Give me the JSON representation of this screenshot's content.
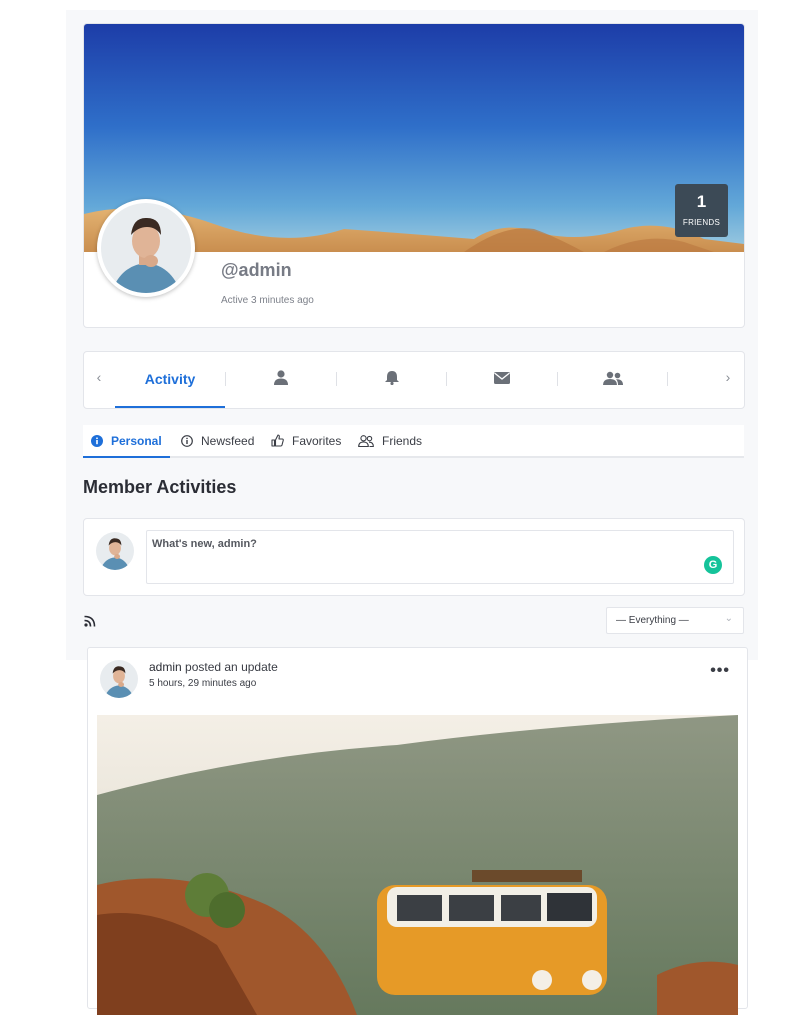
{
  "profile": {
    "username": "@admin",
    "last_active": "Active 3 minutes ago",
    "friends_count": "1",
    "friends_label": "FRIENDS"
  },
  "nav": {
    "prev_icon": "chevron-left-icon",
    "next_icon": "chevron-right-icon",
    "tabs": [
      {
        "label": "Activity",
        "icon": "activity"
      },
      {
        "label": "",
        "icon": "user-icon"
      },
      {
        "label": "",
        "icon": "bell-icon"
      },
      {
        "label": "",
        "icon": "envelope-icon"
      },
      {
        "label": "",
        "icon": "users-icon"
      }
    ]
  },
  "subtabs": [
    {
      "label": "Personal",
      "icon": "info-icon"
    },
    {
      "label": "Newsfeed",
      "icon": "info-outline-icon"
    },
    {
      "label": "Favorites",
      "icon": "thumbs-up-icon"
    },
    {
      "label": "Friends",
      "icon": "users-outline-icon"
    }
  ],
  "section_title": "Member Activities",
  "post_box": {
    "placeholder": "What's new, admin?"
  },
  "filter": {
    "selected": "— Everything —"
  },
  "activity": {
    "author": "admin",
    "action": " posted an update",
    "time": "5 hours, 29 minutes ago",
    "more_label": "•••"
  },
  "colors": {
    "accent": "#1e6fd9",
    "badge_bg": "#3c4a56",
    "grammarly": "#15c39a"
  }
}
